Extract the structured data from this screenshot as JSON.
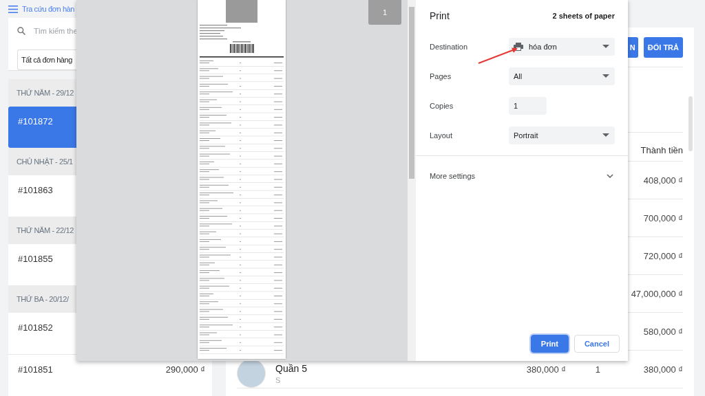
{
  "app": {
    "title": "Tra cứu đơn hàn",
    "search": {
      "placeholder": "Tìm kiếm the"
    },
    "filter": {
      "value": "Tất cả đơn hàng"
    },
    "order_groups": [
      {
        "date": "THỨ NĂM - 29/12",
        "orders": [
          {
            "id": "#101872",
            "selected": true
          }
        ]
      },
      {
        "date": "CHỦ NHẬT - 25/1",
        "orders": [
          {
            "id": "#101863",
            "selected": false
          }
        ]
      },
      {
        "date": "THỨ NĂM - 22/12",
        "orders": [
          {
            "id": "#101855",
            "selected": false
          }
        ]
      },
      {
        "date": "THỨ BA - 20/12/",
        "orders": [
          {
            "id": "#101852",
            "selected": false
          },
          {
            "id": "#101851",
            "total": "290,000 ₫",
            "selected": false
          }
        ]
      }
    ],
    "actions": [
      "N",
      "ĐỔI TRẢ"
    ],
    "items_table": {
      "columns": [
        "Thành tiền"
      ],
      "rows": [
        {
          "kind": "amount",
          "total": "408,000 ₫"
        },
        {
          "kind": "amount",
          "total": "700,000 ₫"
        },
        {
          "kind": "amount",
          "total": "720,000 ₫"
        },
        {
          "kind": "amount",
          "total": "47,000,000 ₫"
        },
        {
          "kind": "amount",
          "total": "580,000 ₫"
        },
        {
          "kind": "product",
          "name": "Quần 5",
          "variant": "S",
          "price": "380,000 ₫",
          "qty": "1",
          "total": "380,000 ₫"
        }
      ]
    }
  },
  "print_dialog": {
    "title": "Print",
    "sheets": "2 sheets of paper",
    "page_number": "1",
    "settings": [
      {
        "kind": "destination",
        "label": "Destination",
        "value": "hóa đơn"
      },
      {
        "kind": "select",
        "label": "Pages",
        "value": "All"
      },
      {
        "kind": "number",
        "label": "Copies",
        "value": "1"
      },
      {
        "kind": "select",
        "label": "Layout",
        "value": "Portrait"
      }
    ],
    "more_settings": {
      "label": "More settings",
      "expanded": false
    },
    "buttons": [
      {
        "label": "Print",
        "primary": true
      },
      {
        "label": "Cancel",
        "primary": false
      }
    ]
  }
}
